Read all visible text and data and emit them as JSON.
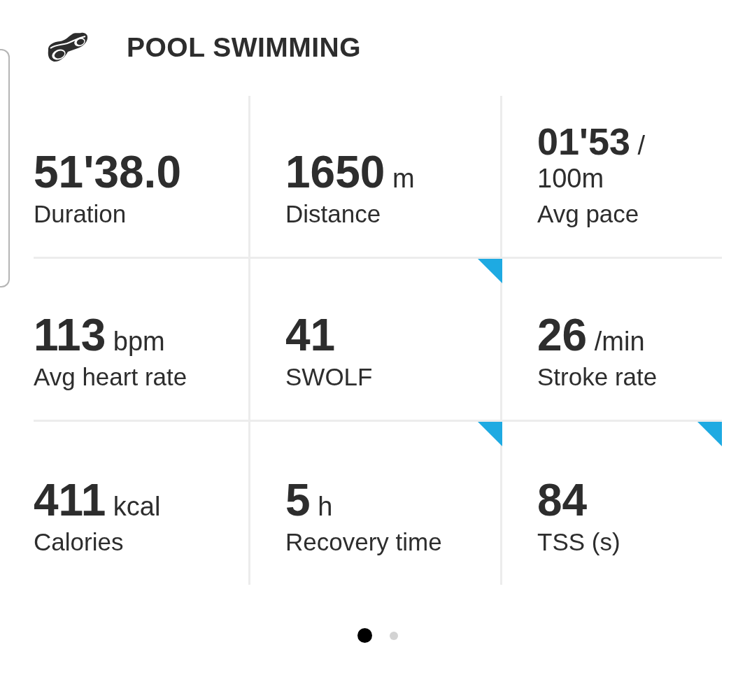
{
  "header": {
    "title": "POOL SWIMMING"
  },
  "metric_rows": [
    {
      "metrics": [
        {
          "value": "51'38.0",
          "label": "Duration",
          "flagged": false
        },
        {
          "value": "1650",
          "unit": "m",
          "label": "Distance",
          "flagged": false
        },
        {
          "value": "01'53",
          "unit": "/ 100m",
          "label": "Avg pace",
          "flagged": false
        }
      ]
    },
    {
      "metrics": [
        {
          "value": "113",
          "unit": "bpm",
          "label": "Avg heart rate",
          "flagged": false
        },
        {
          "value": "41",
          "label": "SWOLF",
          "flagged": true
        },
        {
          "value": "26",
          "unit": "/min",
          "label": "Stroke rate",
          "flagged": false
        }
      ]
    },
    {
      "metrics": [
        {
          "value": "411",
          "unit": "kcal",
          "label": "Calories",
          "flagged": false
        },
        {
          "value": "5",
          "unit": "h",
          "label": "Recovery time",
          "flagged": true
        },
        {
          "value": "84",
          "label": "TSS (s)",
          "flagged": true
        }
      ]
    }
  ],
  "pager": [
    {
      "selected": true
    },
    {
      "selected": false
    }
  ]
}
